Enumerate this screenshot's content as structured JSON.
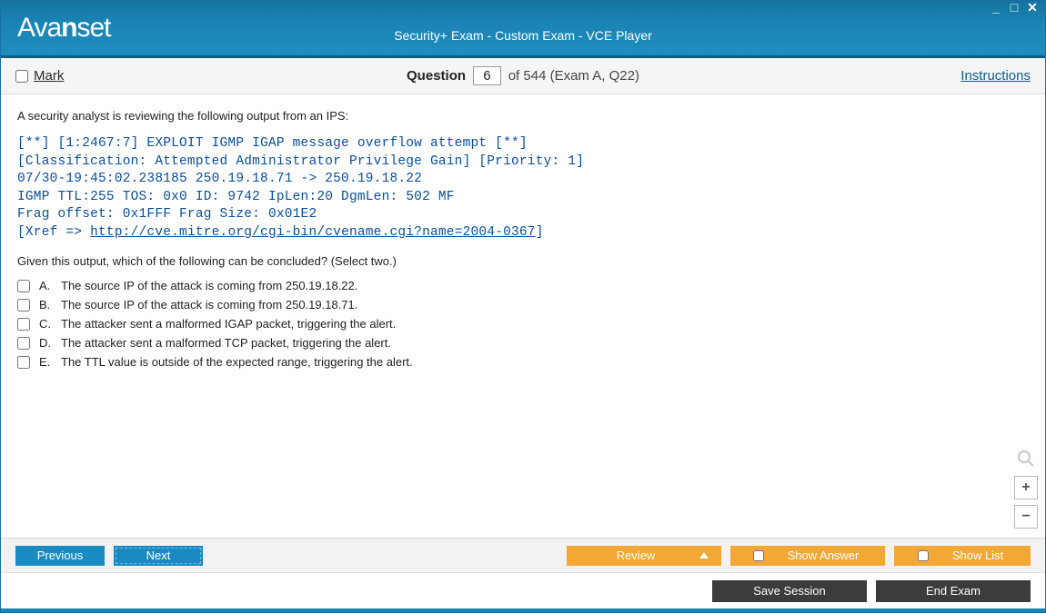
{
  "titlebar": {
    "logo_prefix": "Ava",
    "logo_bold": "n",
    "logo_suffix": "set",
    "title": "Security+ Exam - Custom Exam - VCE Player"
  },
  "qheader": {
    "mark_label": "Mark",
    "question_word": "Question",
    "question_number": "6",
    "of_text": "of 544 (Exam A, Q22)",
    "instructions": "Instructions"
  },
  "question": {
    "intro": "A security analyst is reviewing the following output from an IPS:",
    "mono_lines": [
      "[**] [1:2467:7] EXPLOIT IGMP IGAP message overflow attempt [**]",
      "[Classification: Attempted Administrator Privilege Gain] [Priority: 1]",
      "07/30-19:45:02.238185 250.19.18.71 -> 250.19.18.22",
      "IGMP TTL:255 TOS: 0x0 ID: 9742 IpLen:20 DgmLen: 502 MF",
      "Frag offset: 0x1FFF Frag Size: 0x01E2"
    ],
    "xref_prefix": "[Xref => ",
    "xref_link": "http://cve.mitre.org/cgi-bin/cvename.cgi?name=2004-0367",
    "xref_suffix": "]",
    "followup": "Given this output, which of the following can be concluded? (Select two.)",
    "options": [
      {
        "letter": "A.",
        "text": "The source IP of the attack is coming from 250.19.18.22."
      },
      {
        "letter": "B.",
        "text": "The source IP of the attack is coming from 250.19.18.71."
      },
      {
        "letter": "C.",
        "text": "The attacker sent a malformed IGAP packet, triggering the alert."
      },
      {
        "letter": "D.",
        "text": "The attacker sent a malformed TCP packet, triggering the alert."
      },
      {
        "letter": "E.",
        "text": "The TTL value is outside of the expected range, triggering the alert."
      }
    ]
  },
  "footer": {
    "previous": "Previous",
    "next": "Next",
    "review": "Review",
    "show_answer": "Show Answer",
    "show_list": "Show List",
    "save_session": "Save Session",
    "end_exam": "End Exam"
  },
  "zoom": {
    "plus": "+",
    "minus": "−"
  }
}
